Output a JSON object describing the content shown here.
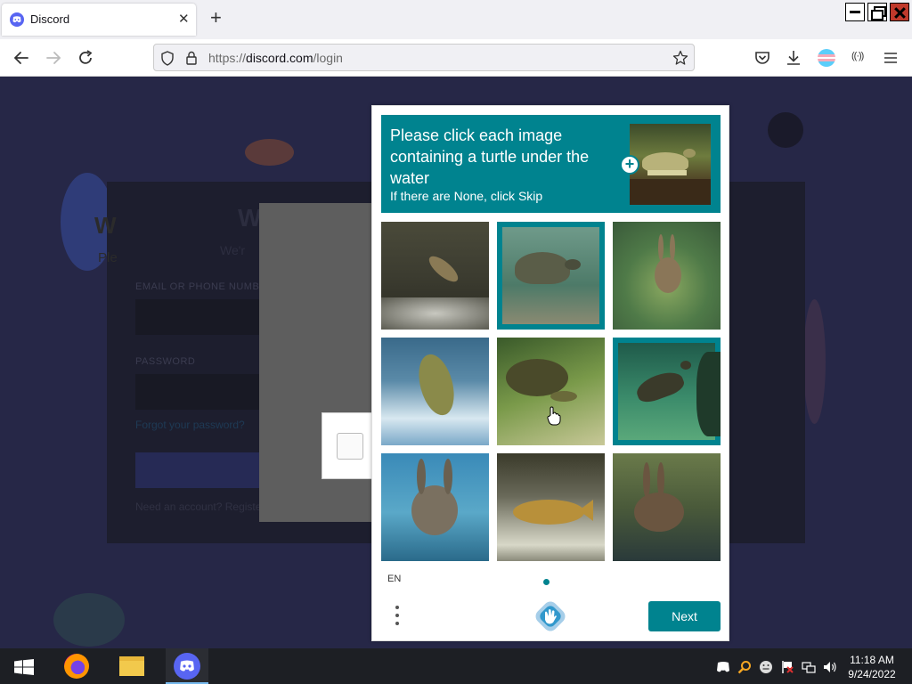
{
  "browser": {
    "tab_title": "Discord",
    "url_scheme": "https://",
    "url_host": "discord.com",
    "url_path": "/login"
  },
  "background_page": {
    "heading": "W",
    "subheading": "We'r",
    "email_label": "EMAIL OR PHONE NUMBER",
    "password_label": "PASSWORD",
    "forgot_link": "Forgot your password?",
    "register_text": "Need an account? Register",
    "inner_heading": "W",
    "inner_sub": "Ple"
  },
  "captcha": {
    "prompt": "Please click each image containing a turtle under the water",
    "sub_prompt": "If there are None, click Skip",
    "language": "EN",
    "next_label": "Next",
    "tiles": [
      {
        "subject": "fish-jumping",
        "selected": false
      },
      {
        "subject": "turtle-underwater",
        "selected": true
      },
      {
        "subject": "rabbit-in-water",
        "selected": false
      },
      {
        "subject": "fish-splashing",
        "selected": false
      },
      {
        "subject": "turtle-swimming",
        "selected": false
      },
      {
        "subject": "turtle-underwater",
        "selected": true
      },
      {
        "subject": "rabbit-in-water",
        "selected": false
      },
      {
        "subject": "fish-in-water",
        "selected": false
      },
      {
        "subject": "rabbit-in-water",
        "selected": false
      }
    ]
  },
  "taskbar": {
    "apps": [
      "firefox-icon",
      "file-explorer-icon",
      "discord-icon"
    ],
    "active_app": "discord-icon",
    "time": "11:18 AM",
    "date": "9/24/2022"
  },
  "colors": {
    "captcha_accent": "#00838f",
    "discord_brand": "#5865f2",
    "page_background": "#262747"
  }
}
